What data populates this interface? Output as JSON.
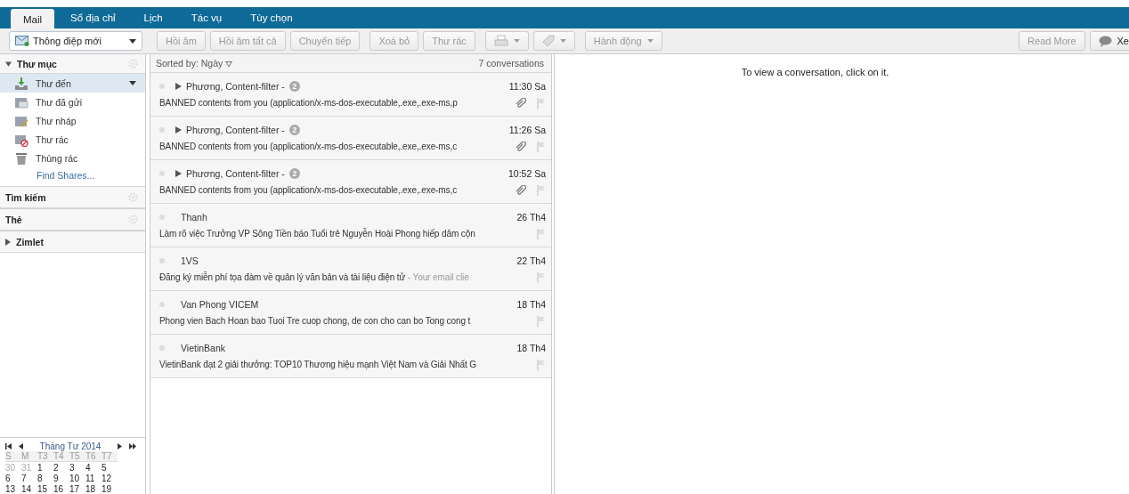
{
  "app_tabs": [
    {
      "label": "Mail",
      "selected": true
    },
    {
      "label": "Sổ địa chỉ",
      "selected": false
    },
    {
      "label": "Lịch",
      "selected": false
    },
    {
      "label": "Tác vụ",
      "selected": false
    },
    {
      "label": "Tùy chọn",
      "selected": false
    }
  ],
  "toolbar": {
    "new_message": "Thông điệp mới",
    "buttons": [
      {
        "label": "Hồi âm",
        "disabled": true
      },
      {
        "label": "Hồi âm tất cả",
        "disabled": true
      },
      {
        "label": "Chuyển tiếp",
        "disabled": true
      },
      {
        "label": "Xoá bỏ",
        "disabled": true
      },
      {
        "label": "Thư rác",
        "disabled": true
      }
    ],
    "actions": "Hành động",
    "read_more": "Read More",
    "view": "Xe"
  },
  "sidebar": {
    "folders_header": "Thư mục",
    "folders": [
      {
        "label": "Thư đến",
        "kind": "inbox",
        "selected": true
      },
      {
        "label": "Thư đã gửi",
        "kind": "sent",
        "selected": false
      },
      {
        "label": "Thư nháp",
        "kind": "drafts",
        "selected": false
      },
      {
        "label": "Thư rác",
        "kind": "junk",
        "selected": false
      },
      {
        "label": "Thùng rác",
        "kind": "trash",
        "selected": false
      }
    ],
    "find_shares": "Find Shares...",
    "sections": [
      {
        "label": "Tìm kiếm",
        "kind": "gear"
      },
      {
        "label": "Thẻ",
        "kind": "gear"
      },
      {
        "label": "Zimlet",
        "kind": "expand"
      }
    ]
  },
  "calendar": {
    "title": "Tháng Tư 2014",
    "weekdays": [
      "S",
      "M",
      "T3",
      "T4",
      "T5",
      "T6",
      "T7"
    ],
    "weeks": [
      [
        {
          "day": "30",
          "other_month": true
        },
        {
          "day": "31",
          "other_month": true
        },
        {
          "day": "1",
          "other_month": false
        },
        {
          "day": "2",
          "other_month": false
        },
        {
          "day": "3",
          "other_month": false
        },
        {
          "day": "4",
          "other_month": false
        },
        {
          "day": "5",
          "other_month": false
        }
      ],
      [
        {
          "day": "6",
          "other_month": false
        },
        {
          "day": "7",
          "other_month": false
        },
        {
          "day": "8",
          "other_month": false
        },
        {
          "day": "9",
          "other_month": false
        },
        {
          "day": "10",
          "other_month": false
        },
        {
          "day": "11",
          "other_month": false
        },
        {
          "day": "12",
          "other_month": false
        }
      ],
      [
        {
          "day": "13",
          "other_month": false
        },
        {
          "day": "14",
          "other_month": false
        },
        {
          "day": "15",
          "other_month": false
        },
        {
          "day": "16",
          "other_month": false
        },
        {
          "day": "17",
          "other_month": false
        },
        {
          "day": "18",
          "other_month": false
        },
        {
          "day": "19",
          "other_month": false
        }
      ]
    ]
  },
  "list": {
    "sort": "Sorted by: Ngày",
    "count": "7 conversations",
    "messages": [
      {
        "sender": "Phương, Content-filter -",
        "badge": "2",
        "time": "11:30 Sa",
        "subject": "BANNED contents from you (application/x-ms-dos-executable,.exe,.exe-ms,p",
        "attachment": true,
        "conversation": true
      },
      {
        "sender": "Phương, Content-filter -",
        "badge": "2",
        "time": "11:26 Sa",
        "subject": "BANNED contents from you (application/x-ms-dos-executable,.exe,.exe-ms,c",
        "attachment": true,
        "conversation": true
      },
      {
        "sender": "Phương, Content-filter -",
        "badge": "2",
        "time": "10:52 Sa",
        "subject": "BANNED contents from you (application/x-ms-dos-executable,.exe,.exe-ms,c",
        "attachment": true,
        "conversation": true
      },
      {
        "sender": "Thanh",
        "time": "26 Th4",
        "subject": "Làm rõ việc Trưởng VP Sông Tiền báo Tuổi trẻ Nguyễn Hoài Phong hiếp dâm cộn",
        "attachment": false,
        "conversation": false
      },
      {
        "sender": "1VS",
        "time": "22 Th4",
        "subject": "Đăng ký miễn phí tọa đàm về quản lý văn bản và tài liệu điện tử",
        "fragment": "- Your email clie",
        "attachment": false,
        "conversation": false
      },
      {
        "sender": "Van Phong VICEM",
        "time": "18 Th4",
        "subject": "Phong vien Bach Hoan bao Tuoi Tre cuop chong, de con cho can bo Tong cong t",
        "attachment": false,
        "conversation": false
      },
      {
        "sender": "VietinBank",
        "time": "18 Th4",
        "subject": "VietinBank đạt 2 giải thưởng: TOP10 Thương hiệu mạnh Việt Nam và Giải Nhất G",
        "attachment": false,
        "conversation": false
      }
    ]
  },
  "reading_pane": {
    "hint": "To view a conversation, click on it."
  }
}
